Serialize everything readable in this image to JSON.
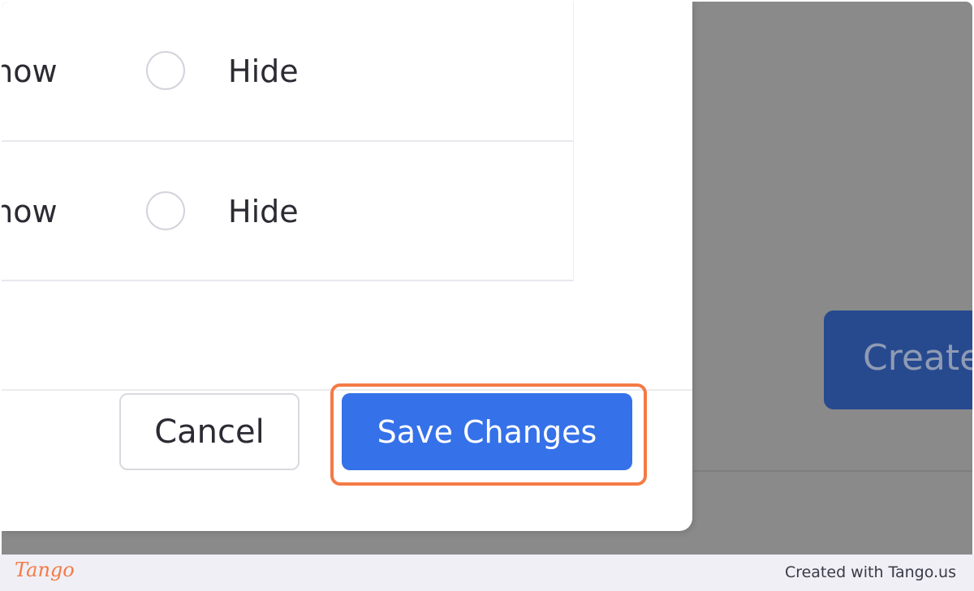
{
  "background": {
    "create_label": "Create"
  },
  "modal": {
    "rows": [
      {
        "show_label": "Show",
        "hide_label": "Hide"
      },
      {
        "show_label": "Show",
        "hide_label": "Hide"
      }
    ],
    "footer": {
      "cancel_label": "Cancel",
      "save_label": "Save Changes"
    }
  },
  "tango": {
    "logo": "Tango",
    "credit": "Created with Tango.us"
  },
  "colors": {
    "primary": "#3571e8",
    "highlight": "#f47a45",
    "overlay": "#8a8a8a"
  }
}
